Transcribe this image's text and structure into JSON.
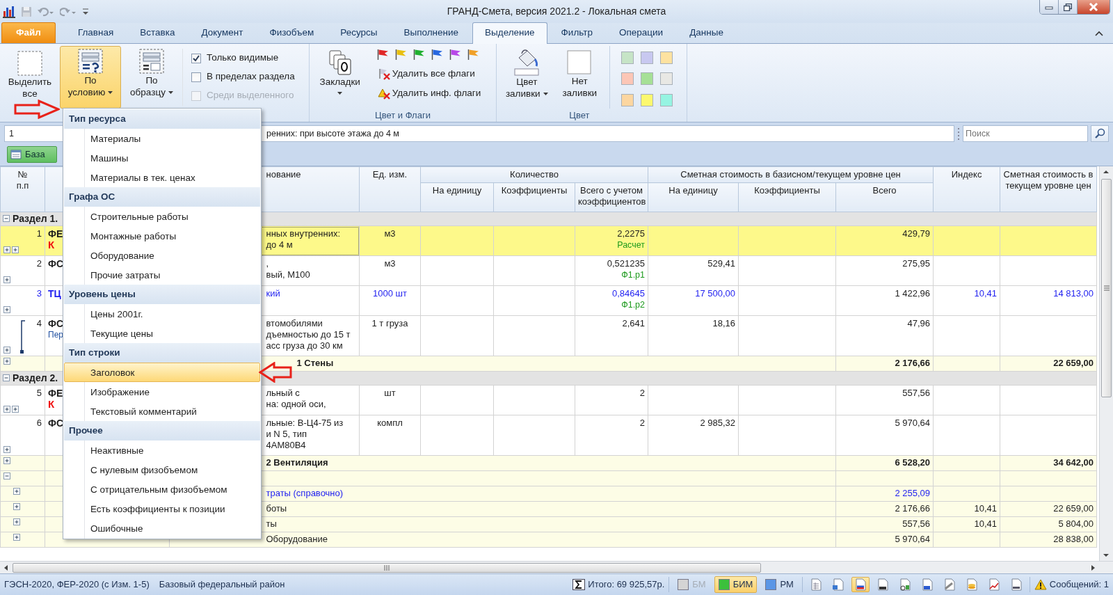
{
  "window": {
    "title": "ГРАНД-Смета, версия 2021.2 - Локальная смета"
  },
  "tabs": [
    {
      "label": "Файл",
      "kind": "file",
      "selected": false
    },
    {
      "label": "Главная",
      "kind": "tab",
      "selected": false
    },
    {
      "label": "Вставка",
      "kind": "tab",
      "selected": false
    },
    {
      "label": "Документ",
      "kind": "tab",
      "selected": false
    },
    {
      "label": "Физобъем",
      "kind": "tab",
      "selected": false
    },
    {
      "label": "Ресурсы",
      "kind": "tab",
      "selected": false
    },
    {
      "label": "Выполнение",
      "kind": "tab",
      "selected": false
    },
    {
      "label": "Выделение",
      "kind": "tab",
      "selected": true
    },
    {
      "label": "Фильтр",
      "kind": "tab",
      "selected": false
    },
    {
      "label": "Операции",
      "kind": "tab",
      "selected": false
    },
    {
      "label": "Данные",
      "kind": "tab",
      "selected": false
    }
  ],
  "ribbon": {
    "select_all": {
      "label": [
        "Выделить",
        "все"
      ]
    },
    "by_condition": {
      "label": [
        "По",
        "условию"
      ],
      "selected": true
    },
    "by_sample": {
      "label": [
        "По",
        "образцу"
      ],
      "selected": false
    },
    "options": [
      {
        "label": "Только видимые",
        "checked": true,
        "disabled": false
      },
      {
        "label": "В пределах раздела",
        "checked": false,
        "disabled": false
      },
      {
        "label": "Среди выделенного",
        "checked": false,
        "disabled": true
      }
    ],
    "bookmarks": {
      "label": "Закладки"
    },
    "flags": [
      {
        "color": "#e02828"
      },
      {
        "color": "#e8c010"
      },
      {
        "color": "#20b030"
      },
      {
        "color": "#2868e0"
      },
      {
        "color": "#b848e8"
      },
      {
        "color": "#f0a028"
      }
    ],
    "flag_actions": [
      {
        "label": "Удалить все флаги"
      },
      {
        "label": "Удалить инф. флаги"
      }
    ],
    "flags_group": "Цвет и Флаги",
    "fill_color": {
      "label": [
        "Цвет",
        "заливки"
      ]
    },
    "no_fill": {
      "label": [
        "Нет",
        "заливки"
      ]
    },
    "swatches": [
      {
        "color": "#c6e4c6"
      },
      {
        "color": "#c8c8f0"
      },
      {
        "color": "#fde2a0"
      },
      {
        "color": "#fcc6b6"
      },
      {
        "color": "#a6e096"
      },
      {
        "color": "#e8e8e4"
      },
      {
        "color": "#fcd6a0"
      },
      {
        "color": "#fcf86e"
      },
      {
        "color": "#96f4e2"
      }
    ],
    "color_group": "Цвет"
  },
  "formula_bar": {
    "cell": "1",
    "value": "ренних: при высоте этажа до 4 м",
    "search_placeholder": "Поиск"
  },
  "base_tab": {
    "label": "База"
  },
  "table": {
    "header": {
      "number": [
        "№",
        "п.п"
      ],
      "name": "нование",
      "unit": "Ед. изм.",
      "quantity": {
        "label": "Количество",
        "columns": [
          "На единицу",
          "Коэффициенты",
          "Всего с учетом коэффициентов"
        ]
      },
      "cost": {
        "label": "Сметная стоимость в базисном/текущем уровне цен",
        "columns": [
          "На единицу",
          "Коэффициенты",
          "Всего"
        ]
      },
      "index": "Индекс",
      "current_cost": "Сметная стоимость в текущем уровне цен"
    },
    "rows": [
      {
        "kind": "section",
        "label": "Раздел 1."
      },
      {
        "kind": "item",
        "selected": true,
        "number": "1",
        "code": "ФЕ",
        "coef": "К",
        "name": [
          "нных внутренних:",
          "до 4 м"
        ],
        "unit": "м3",
        "q_total": "2,2275",
        "q_note": "Расчет",
        "c_total": "429,79"
      },
      {
        "kind": "item",
        "selected": false,
        "number": "2",
        "code": "ФС",
        "name": [
          ",",
          "вый, М100"
        ],
        "unit": "м3",
        "q_total": "0,521235",
        "q_note": "Ф1.р1",
        "c_unit": "529,41",
        "c_total": "275,95"
      },
      {
        "kind": "price_item",
        "selected": false,
        "number": "3",
        "code": "ТЦ",
        "name": [
          "кий"
        ],
        "unit": "1000 шт",
        "q_total": "0,84645",
        "q_note": "Ф1.р2",
        "c_unit": "17 500,00",
        "c_total": "1 422,96",
        "index": "10,41",
        "current": "14 813,00"
      },
      {
        "kind": "item",
        "selected": false,
        "linked": true,
        "number": "4",
        "code": "ФС",
        "sub": "Пер",
        "name": [
          "втомобилями",
          "дъемностью до 15 т",
          "асс груза до 30 км"
        ],
        "unit": "1 т груза",
        "q_total": "2,641",
        "c_unit": "18,16",
        "c_total": "47,96"
      },
      {
        "kind": "total",
        "label": "1 Стены",
        "c_total": "2 176,66",
        "current": "22 659,00"
      },
      {
        "kind": "section",
        "label": "Раздел 2."
      },
      {
        "kind": "item",
        "selected": false,
        "number": "5",
        "code": "ФЕ",
        "coef": "К",
        "name": [
          "льный с",
          "на: одной оси,"
        ],
        "unit": "шт",
        "q_total": "2",
        "c_total": "557,56"
      },
      {
        "kind": "item",
        "selected": false,
        "number": "6",
        "code": "ФС",
        "name": [
          "льные: В-Ц4-75 из",
          "и N 5, тип",
          "4АМ80В4"
        ],
        "unit": "компл",
        "q_total": "2",
        "c_unit": "2 985,32",
        "c_total": "5 970,64"
      },
      {
        "kind": "total",
        "label": "2 Вентиляция",
        "c_total": "6 528,20",
        "current": "34 642,00"
      },
      {
        "kind": "summary_group"
      },
      {
        "kind": "reference_line",
        "label": "траты (справочно)",
        "c_total": "2 255,09"
      },
      {
        "kind": "summary_line",
        "label": "боты",
        "c_total": "2 176,66",
        "index": "10,41",
        "current": "22 659,00"
      },
      {
        "kind": "summary_line",
        "label": "ты",
        "c_total": "557,56",
        "index": "10,41",
        "current": "5 804,00"
      },
      {
        "kind": "summary_line",
        "label": "Оборудование",
        "c_total": "5 970,64",
        "current": "28 838,00"
      }
    ]
  },
  "dropdown": {
    "sections": [
      {
        "title": "Тип ресурса",
        "items": [
          {
            "label": "Материалы",
            "selected": false
          },
          {
            "label": "Машины",
            "selected": false
          },
          {
            "label": "Материалы в тек. ценах",
            "selected": false
          }
        ]
      },
      {
        "title": "Графа ОС",
        "items": [
          {
            "label": "Строительные работы",
            "selected": false
          },
          {
            "label": "Монтажные работы",
            "selected": false
          },
          {
            "label": "Оборудование",
            "selected": false
          },
          {
            "label": "Прочие затраты",
            "selected": false
          }
        ]
      },
      {
        "title": "Уровень цены",
        "items": [
          {
            "label": "Цены 2001г.",
            "selected": false
          },
          {
            "label": "Текущие цены",
            "selected": false
          }
        ]
      },
      {
        "title": "Тип строки",
        "items": [
          {
            "label": "Заголовок",
            "selected": true
          },
          {
            "label": "Изображение",
            "selected": false
          },
          {
            "label": "Текстовый комментарий",
            "selected": false
          }
        ]
      },
      {
        "title": "Прочее",
        "items": [
          {
            "label": "Неактивные",
            "selected": false
          },
          {
            "label": "С нулевым физобъемом",
            "selected": false
          },
          {
            "label": "С отрицательным физобъемом",
            "selected": false
          },
          {
            "label": "Есть коэффициенты к позиции",
            "selected": false
          },
          {
            "label": "Ошибочные",
            "selected": false
          }
        ]
      }
    ]
  },
  "status_bar": {
    "base": "ГЭСН-2020, ФЕР-2020 (с Изм. 1-5)",
    "region": "Базовый федеральный район",
    "total": "Итого: 69 925,57р.",
    "modes": [
      {
        "label": "БМ",
        "selected": false,
        "disabled": true,
        "color": "#d4d4d4"
      },
      {
        "label": "БИМ",
        "selected": true,
        "disabled": false,
        "color": "#3cc03c"
      },
      {
        "label": "РМ",
        "selected": false,
        "disabled": false,
        "color": "#5a96e6"
      }
    ],
    "tools": [
      {
        "selected": false
      },
      {
        "selected": false
      },
      {
        "selected": true
      },
      {
        "selected": false
      },
      {
        "selected": false
      },
      {
        "selected": false
      },
      {
        "selected": false
      },
      {
        "selected": false
      },
      {
        "selected": false
      },
      {
        "selected": false
      }
    ],
    "messages": "Сообщений: 1"
  }
}
